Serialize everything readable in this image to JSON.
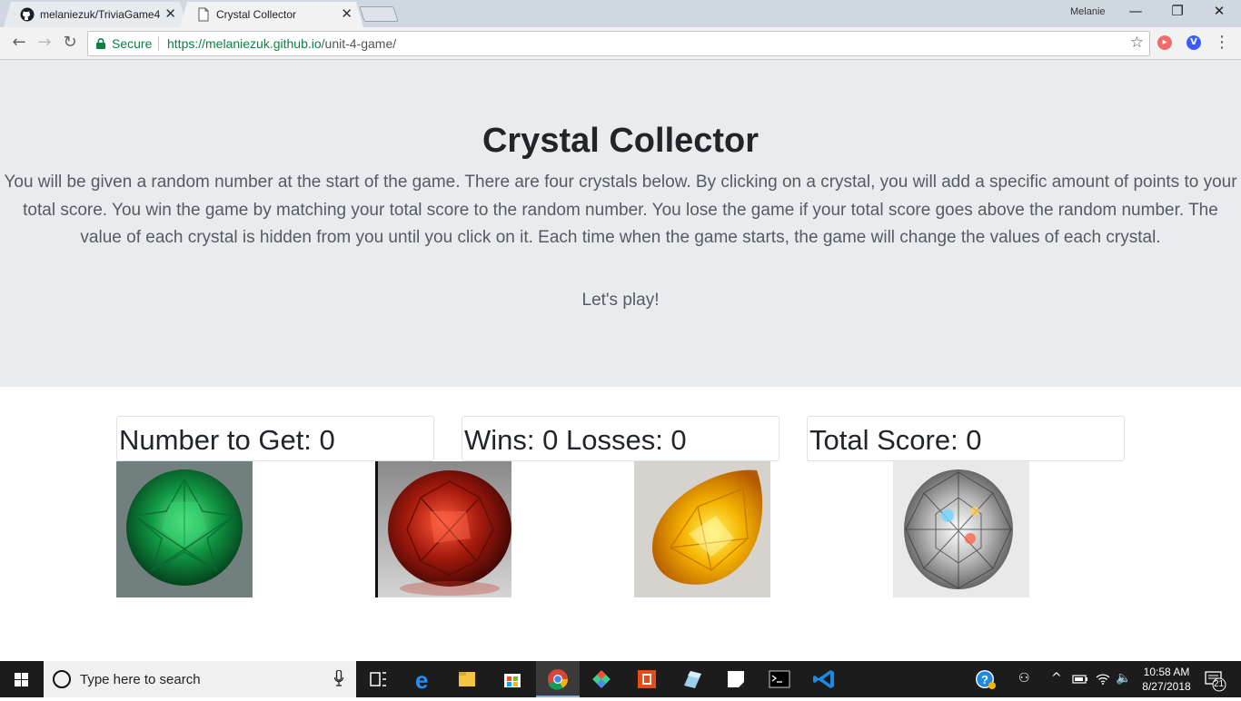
{
  "browser": {
    "tabs": [
      {
        "label": "melaniezuk/TriviaGame4",
        "icon": "github-icon"
      },
      {
        "label": "Crystal Collector",
        "icon": "page-icon"
      }
    ],
    "profile": "Melanie",
    "secure_label": "Secure",
    "url_host": "https://melaniezuk.github.io",
    "url_path": "/unit-4-game/"
  },
  "page": {
    "title": "Crystal Collector",
    "description": "You will be given a random number at the start of the game. There are four crystals below. By clicking on a crystal, you will add a specific amount of points to your total score. You win the game by matching your total score to the random number. You lose the game if your total score goes above the random number. The value of each crystal is hidden from you until you click on it. Each time when the game starts, the game will change the values of each crystal.",
    "prompt": "Let's play!",
    "number_to_get": "Number to Get: 0",
    "wins_losses": "Wins: 0 Losses: 0",
    "total_score": "Total Score: 0",
    "crystals": [
      "green emerald",
      "red garnet",
      "yellow sapphire",
      "white diamond"
    ]
  },
  "taskbar": {
    "search_placeholder": "Type here to search",
    "time": "10:58 AM",
    "date": "8/27/2018",
    "notifications": "21"
  },
  "colors": {
    "jumbotron_bg": "#e9ecef",
    "secure_green": "#0b8043",
    "taskbar_bg": "#1c1c1c"
  }
}
